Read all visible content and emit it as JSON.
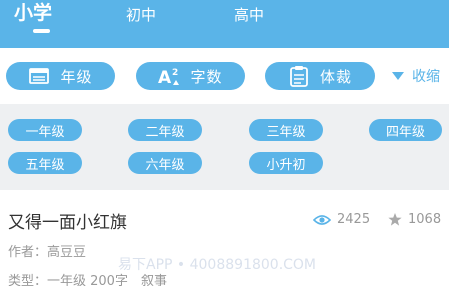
{
  "tabs": [
    {
      "label": "小学",
      "active": true
    },
    {
      "label": "初中",
      "active": false
    },
    {
      "label": "高中",
      "active": false
    }
  ],
  "filters": [
    {
      "label": "年级",
      "icon": "calendar-icon"
    },
    {
      "label": "字数",
      "icon": "font-size-icon"
    },
    {
      "label": "体裁",
      "icon": "clipboard-icon"
    }
  ],
  "collapse_label": "收缩",
  "grades": [
    "一年级",
    "二年级",
    "三年级",
    "四年级",
    "五年级",
    "六年级",
    "小升初"
  ],
  "article": {
    "title": "又得一面小红旗",
    "views": "2425",
    "likes": "1068",
    "author": "作者：高豆豆",
    "type": "类型：一年级 200字　叙事"
  },
  "watermark": "易下APP • 4008891800.COM",
  "colors": {
    "accent": "#5ab4e8",
    "panel": "#eef0f2",
    "muted": "#999999"
  }
}
